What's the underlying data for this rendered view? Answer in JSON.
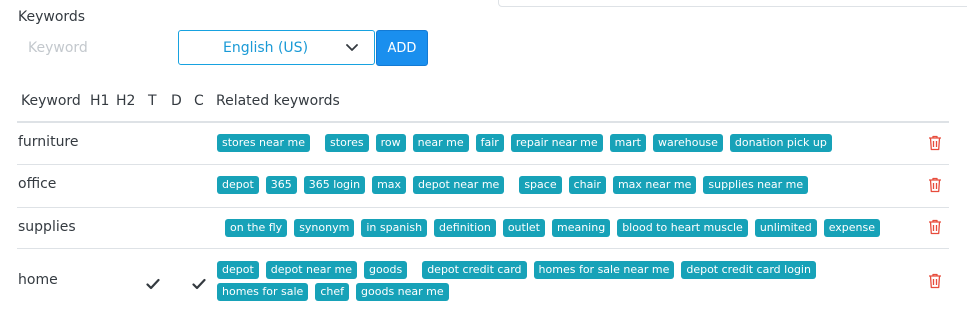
{
  "form": {
    "label": "Keywords",
    "keyword_placeholder": "Keyword",
    "language": "English (US)",
    "add_label": "ADD"
  },
  "table": {
    "headers": {
      "keyword": "Keyword",
      "h1": "H1",
      "h2": "H2",
      "t": "T",
      "d": "D",
      "c": "C",
      "related": "Related keywords"
    },
    "rows": [
      {
        "keyword": "furniture",
        "t": false,
        "d": false,
        "c": false,
        "related": [
          "stores near me",
          "stores",
          "row",
          "near me",
          "fair",
          "repair near me",
          "mart",
          "warehouse",
          "donation pick up"
        ]
      },
      {
        "keyword": "office",
        "t": false,
        "d": false,
        "c": false,
        "related": [
          "depot",
          "365",
          "365 login",
          "max",
          "depot near me",
          "space",
          "chair",
          "max near me",
          "supplies near me"
        ]
      },
      {
        "keyword": "supplies",
        "t": false,
        "d": false,
        "c": false,
        "related": [
          "on the fly",
          "synonym",
          "in spanish",
          "definition",
          "outlet",
          "meaning",
          "blood to heart muscle",
          "unlimited",
          "expense"
        ]
      },
      {
        "keyword": "home",
        "t": true,
        "d": false,
        "c": true,
        "related": [
          "depot",
          "depot near me",
          "goods",
          "depot credit card",
          "homes for sale near me",
          "depot credit card login",
          "homes for sale",
          "chef",
          "goods near me"
        ]
      }
    ]
  },
  "colors": {
    "tag": "#17a2b8",
    "add_button": "#1a8fee",
    "trash": "#e74c3c",
    "check": "#343a40",
    "select_border": "#17a2e0"
  },
  "icons": {
    "dropdown": "chevron-down-icon",
    "delete": "trash-icon",
    "checked": "check-icon"
  }
}
